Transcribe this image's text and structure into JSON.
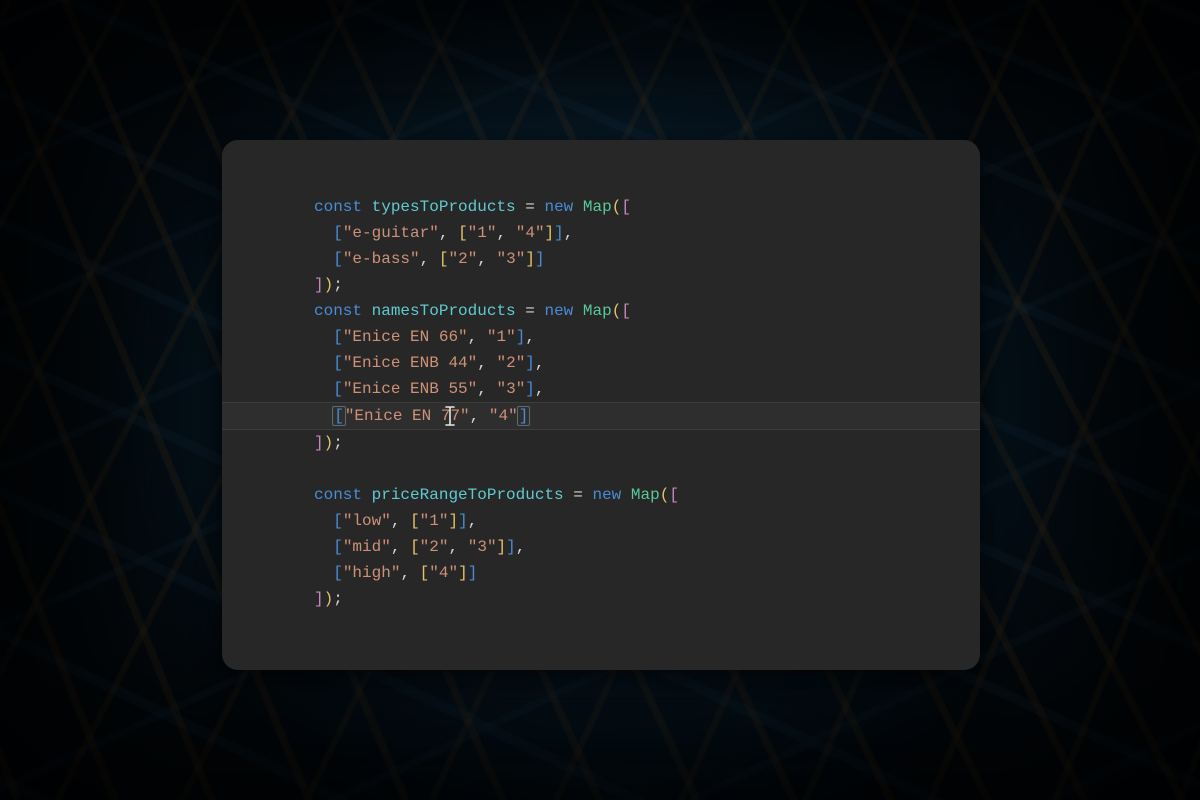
{
  "colors": {
    "editor_bg": "#272727",
    "kw": "#4a8bd6",
    "var": "#5fcad0",
    "type": "#58c99b",
    "str": "#ce9178",
    "bracket_yellow": "#e2c26b",
    "bracket_pink": "#c586c0",
    "bracket_blue": "#4a8bd6"
  },
  "kw_const": "const",
  "kw_new": "new",
  "class_map": "Map",
  "semi": ";",
  "comma": ",",
  "eq": " = ",
  "cursor_line_index": 9,
  "b1": {
    "name": "typesToProducts",
    "rows": [
      {
        "key": "e-guitar",
        "vals": [
          "1",
          "4"
        ]
      },
      {
        "key": "e-bass",
        "vals": [
          "2",
          "3"
        ]
      }
    ]
  },
  "b2": {
    "name": "namesToProducts",
    "rows": [
      {
        "key": "Enice EN 66",
        "val": "1"
      },
      {
        "key": "Enice ENB 44",
        "val": "2"
      },
      {
        "key": "Enice ENB 55",
        "val": "3"
      },
      {
        "key_a": "Enice EN 7",
        "key_b": "7",
        "val": "4",
        "cursor": true
      }
    ]
  },
  "b3": {
    "name": "priceRangeToProducts",
    "rows": [
      {
        "key": "low",
        "vals": [
          "1"
        ]
      },
      {
        "key": "mid",
        "vals": [
          "2",
          "3"
        ]
      },
      {
        "key": "high",
        "vals": [
          "4"
        ]
      }
    ]
  },
  "q": "\"",
  "sp2": "  ",
  "lpar": "(",
  "rpar": ")",
  "lbr": "[",
  "rbr": "]",
  "close_line": "]);"
}
